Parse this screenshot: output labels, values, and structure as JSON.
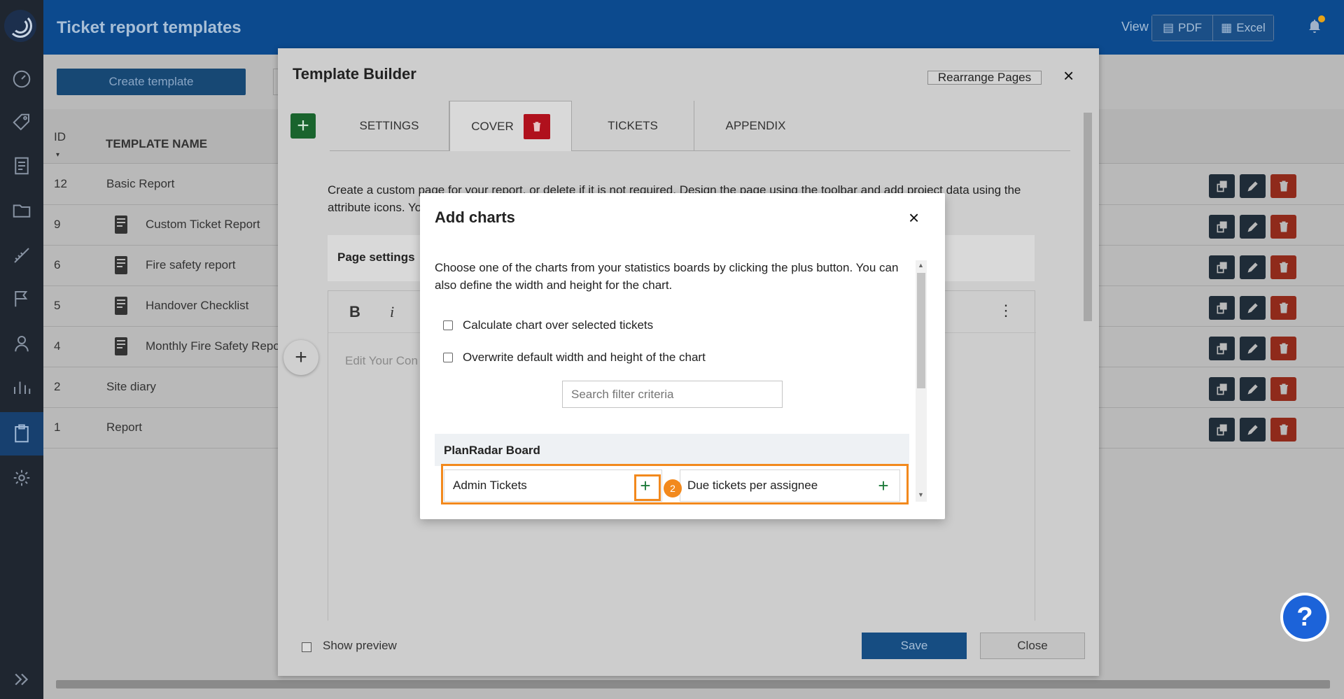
{
  "header": {
    "title": "Ticket report templates",
    "view_label": "View",
    "export_pdf": "PDF",
    "export_excel": "Excel"
  },
  "list": {
    "create_button": "Create template",
    "col_id": "ID",
    "col_name": "TEMPLATE NAME",
    "rows": [
      {
        "id": "12",
        "name": "Basic Report"
      },
      {
        "id": "9",
        "name": "Custom Ticket Report"
      },
      {
        "id": "6",
        "name": "Fire safety report"
      },
      {
        "id": "5",
        "name": "Handover Checklist"
      },
      {
        "id": "4",
        "name": "Monthly Fire Safety Repo"
      },
      {
        "id": "2",
        "name": "Site diary"
      },
      {
        "id": "1",
        "name": "Report"
      }
    ]
  },
  "builder": {
    "title": "Template Builder",
    "rearrange_button": "Rearrange Pages",
    "close_icon": "×",
    "tabs": [
      "SETTINGS",
      "COVER",
      "TICKETS",
      "APPENDIX"
    ],
    "active_tab": "COVER",
    "intro_line1": "Create a custom page for your report, or delete if it is not required. Design the page using the toolbar and add project data using the",
    "intro_line2": "attribute icons. Yo",
    "page_settings_label": "Page settings",
    "editor_bold": "B",
    "editor_italic": "i",
    "editor_more": "⋮",
    "editor_placeholder": "Edit Your Con",
    "show_preview_label": "Show preview",
    "save_button": "Save",
    "close_button": "Close"
  },
  "modal": {
    "title": "Add charts",
    "close_icon": "×",
    "description": "Choose one of the charts from your statistics boards by clicking the plus button. You can also define the width and height for the chart.",
    "option_calculate": "Calculate chart over selected tickets",
    "option_overwrite": "Overwrite default width and height of the chart",
    "search_placeholder": "Search filter criteria",
    "board_name": "PlanRadar Board",
    "charts": [
      {
        "name": "Admin Tickets"
      },
      {
        "name": "Due tickets per assignee"
      }
    ],
    "plus_symbol": "+",
    "step_number": "2"
  },
  "help": {
    "label": "?"
  },
  "colors": {
    "brand_blue": "#0c4a8e",
    "highlight_orange": "#f2891d",
    "add_green": "#1d7a3a",
    "delete_red": "#b0111d",
    "help_blue": "#1c63d9"
  },
  "icons": {
    "sidebar": [
      "logo-icon",
      "dashboard-icon",
      "tag-icon",
      "report-icon",
      "folder-icon",
      "ruler-icon",
      "flag-icon",
      "user-icon",
      "chart-icon",
      "clipboard-icon",
      "settings-icon",
      "expand-icon"
    ],
    "row_actions": [
      "copy-icon",
      "edit-icon",
      "trash-icon"
    ]
  }
}
